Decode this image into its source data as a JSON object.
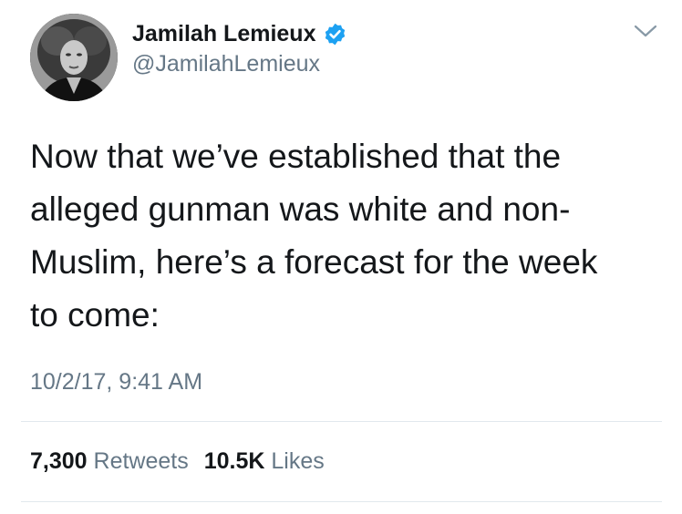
{
  "author": {
    "display_name": "Jamilah Lemieux",
    "handle": "@JamilahLemieux",
    "verified_icon": "verified-badge-icon",
    "avatar_icon": "profile-photo-avatar"
  },
  "menu_icon": "chevron-down-icon",
  "tweet": {
    "lines": [
      "Now that we’ve established that the",
      "alleged gunman was white and non-",
      "Muslim, here’s a forecast for the week",
      "to come:"
    ],
    "timestamp": "10/2/17, 9:41 AM"
  },
  "stats": {
    "retweets_value": "7,300",
    "retweets_label": "Retweets",
    "likes_value": "10.5K",
    "likes_label": "Likes"
  },
  "colors": {
    "text_primary": "#14171a",
    "text_secondary": "#657786",
    "verified_blue": "#1da1f2",
    "divider": "#e1e8ed"
  }
}
